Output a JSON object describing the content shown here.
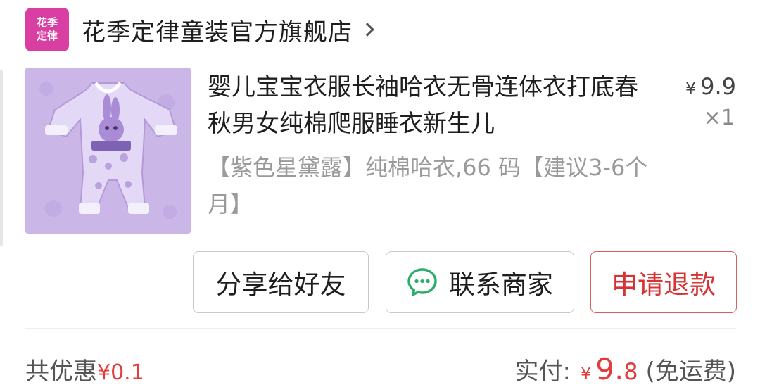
{
  "shop": {
    "logo_line1": "花季",
    "logo_line2": "定律",
    "name": "花季定律童装官方旗舰店"
  },
  "product": {
    "title": "婴儿宝宝衣服长袖哈衣无骨连体衣打底春秋男女纯棉爬服睡衣新生儿",
    "price_symbol": "¥",
    "price": "9.9",
    "quantity": "×1",
    "spec": "【紫色星黛露】纯棉哈衣,66 码【建议3-6个月】"
  },
  "actions": {
    "share": "分享给好友",
    "contact": "联系商家",
    "refund": "申请退款"
  },
  "summary": {
    "discount_label": "共优惠",
    "discount_amount": "¥0.1",
    "paid_label": "实付:",
    "paid_symbol": "¥",
    "paid_int": "9.",
    "paid_dec": "8",
    "shipping_note": "(免运费)"
  },
  "colors": {
    "logo": "#d93fa2",
    "accent_red": "#d63434",
    "product_bg": "#cdb8ea",
    "wechat_green": "#2aae67"
  }
}
